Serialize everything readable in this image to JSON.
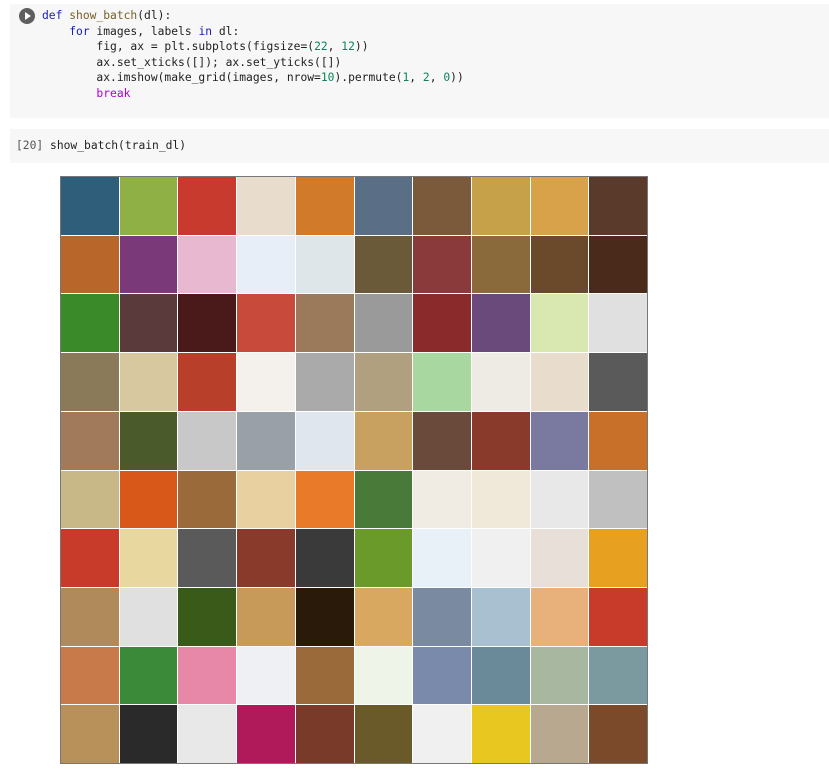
{
  "cell1": {
    "code_lines": [
      [
        {
          "t": "def ",
          "c": "kw"
        },
        {
          "t": "show_batch",
          "c": "fn"
        },
        {
          "t": "(dl):",
          "c": ""
        }
      ],
      [
        {
          "t": "    ",
          "c": ""
        },
        {
          "t": "for",
          "c": "kw"
        },
        {
          "t": " images, labels ",
          "c": ""
        },
        {
          "t": "in",
          "c": "kw"
        },
        {
          "t": " dl:",
          "c": ""
        }
      ],
      [
        {
          "t": "        fig, ax = plt.subplots(figsize=(",
          "c": ""
        },
        {
          "t": "22",
          "c": "num"
        },
        {
          "t": ", ",
          "c": ""
        },
        {
          "t": "12",
          "c": "num"
        },
        {
          "t": "))",
          "c": ""
        }
      ],
      [
        {
          "t": "        ax.set_xticks([]); ax.set_yticks([])",
          "c": ""
        }
      ],
      [
        {
          "t": "        ax.imshow(make_grid(images, nrow=",
          "c": ""
        },
        {
          "t": "10",
          "c": "num"
        },
        {
          "t": ").permute(",
          "c": ""
        },
        {
          "t": "1",
          "c": "num"
        },
        {
          "t": ", ",
          "c": ""
        },
        {
          "t": "2",
          "c": "num"
        },
        {
          "t": ", ",
          "c": ""
        },
        {
          "t": "0",
          "c": "num"
        },
        {
          "t": "))",
          "c": ""
        }
      ],
      [
        {
          "t": "        ",
          "c": ""
        },
        {
          "t": "break",
          "c": "brk"
        }
      ]
    ]
  },
  "cell2": {
    "prompt": "[20]",
    "code": "show_batch(train_dl)"
  },
  "output": {
    "grid_columns": 10,
    "grid_rows": 10,
    "tile_colors": [
      "#2e5e7a",
      "#8fb045",
      "#c83a2e",
      "#e8dccc",
      "#d07a2a",
      "#5a6f86",
      "#7a5a3a",
      "#c7a04a",
      "#d8a24a",
      "#5a3a2a",
      "#b8662a",
      "#7a3a7a",
      "#e8b8d0",
      "#e8eef8",
      "#dfe6ea",
      "#6a5a3a",
      "#8a3a3a",
      "#8a6a3a",
      "#6a4a2a",
      "#4a2a1a",
      "#3a8a2a",
      "#5a3a3a",
      "#4a1a1a",
      "#c84a3a",
      "#9a7a5a",
      "#9a9a9a",
      "#8a2a2a",
      "#6a4a7a",
      "#d8e8b0",
      "#e0e0e0",
      "#8a7a5a",
      "#d8c8a0",
      "#b8402a",
      "#f4f0ec",
      "#aaaaaa",
      "#b0a080",
      "#a8d8a0",
      "#eeeae4",
      "#e8dccc",
      "#5a5a5a",
      "#a07a5a",
      "#4a5a2a",
      "#c8c8c8",
      "#9aa0a8",
      "#dfe6ee",
      "#c8a060",
      "#6a4a3a",
      "#8a3a2a",
      "#7a7aa0",
      "#c8702a",
      "#c8b888",
      "#d8581a",
      "#9a6a3a",
      "#e8d0a0",
      "#e87a2a",
      "#4a7a3a",
      "#f0ece4",
      "#f0e8d8",
      "#e8e8e8",
      "#c0c0c0",
      "#c83a2a",
      "#e8d8a0",
      "#5a5a5a",
      "#8a3a2a",
      "#3a3a3a",
      "#6a9a2a",
      "#e8f0f8",
      "#f0f0f0",
      "#e8e0d8",
      "#e8a020",
      "#b08a5a",
      "#e0e0e0",
      "#3a5a1a",
      "#c89a5a",
      "#2a1a0a",
      "#d8a860",
      "#7a8aa0",
      "#a8c0d0",
      "#e8b07a",
      "#c83a2a",
      "#c87a4a",
      "#3a8a3a",
      "#e888a8",
      "#eef0f4",
      "#9a6a3a",
      "#eef4e8",
      "#7a8aaa",
      "#6a8a9a",
      "#a8b8a0",
      "#7a9aa0",
      "#b8905a",
      "#2a2a2a",
      "#e8e8e8",
      "#b01a5a",
      "#7a3a2a",
      "#6a5a2a",
      "#f0f0f0",
      "#e8c820",
      "#b8a890",
      "#7a4a2a"
    ]
  }
}
